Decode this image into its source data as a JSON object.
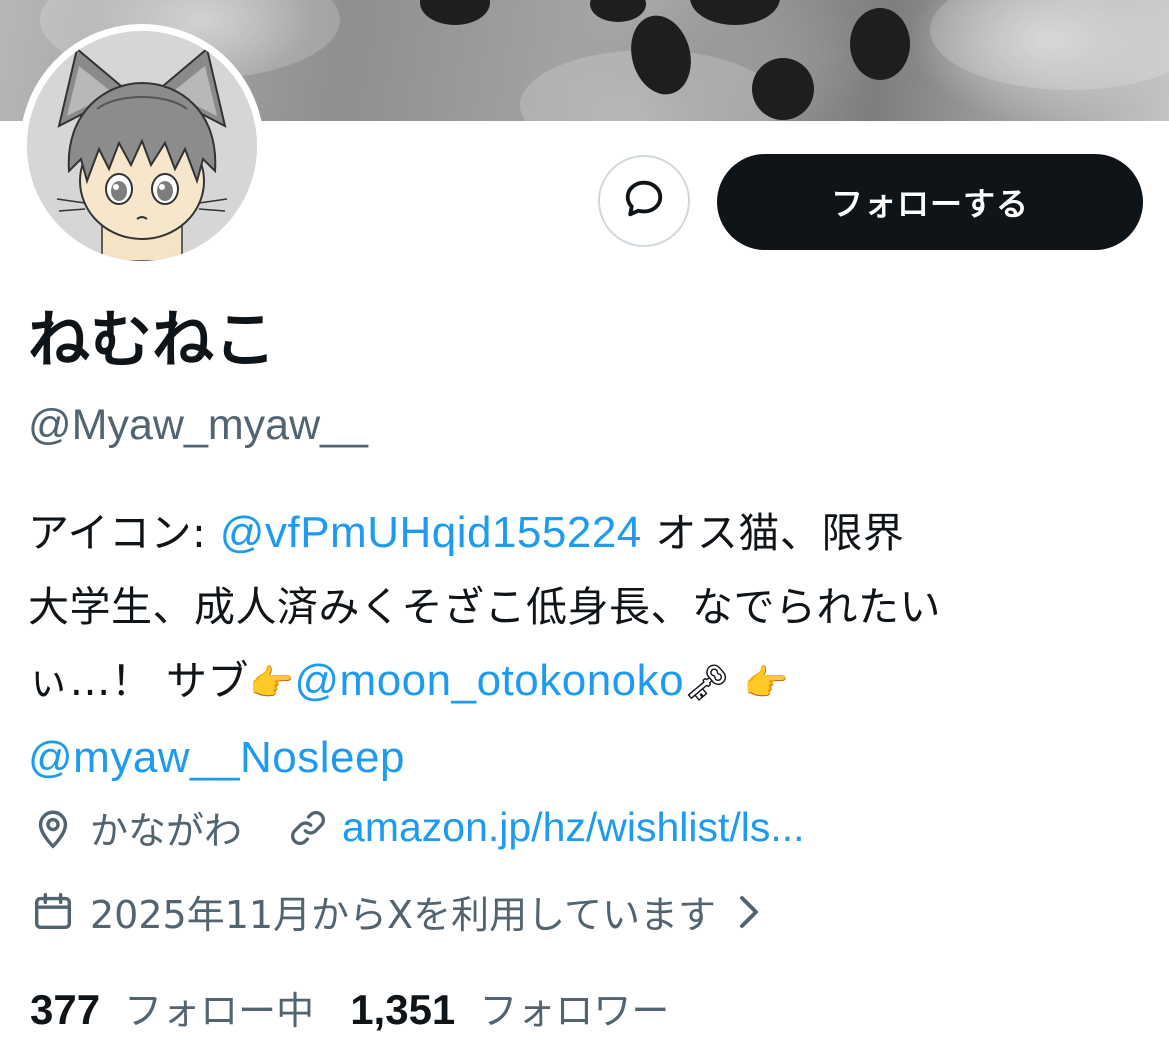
{
  "profile": {
    "display_name": "ねむねこ",
    "handle": "@Myaw_myaw__",
    "follow_label": "フォローする"
  },
  "bio": {
    "line1_prefix": "アイコン: ",
    "line1_mention": "@vfPmUHqid155224",
    "line1_suffix": " オス猫、限界",
    "line2": "大学生、成人済みくそざこ低身長、なでられたい",
    "line3_prefix": "ぃ…！ サブ",
    "emoji_point": "👉",
    "line3_mention": "@moon_otokonoko",
    "emoji_key": "🗝",
    "line4_mention": "@myaw__Nosleep"
  },
  "meta": {
    "location": "かながわ",
    "url": "amazon.jp/hz/wishlist/ls...",
    "joined": "2025年11月からXを利用しています"
  },
  "stats": {
    "following_count": "377",
    "following_label": "フォロー中",
    "followers_count": "1,351",
    "followers_label": "フォロワー"
  },
  "icons": {
    "message": "message-icon",
    "location": "location-pin-icon",
    "link": "link-icon",
    "calendar": "calendar-icon",
    "chevron": "chevron-right-icon"
  },
  "colors": {
    "text": "#0f1419",
    "secondary": "#536471",
    "link": "#1d9bf0",
    "button_bg": "#0f1419",
    "border": "#cfd9de"
  }
}
